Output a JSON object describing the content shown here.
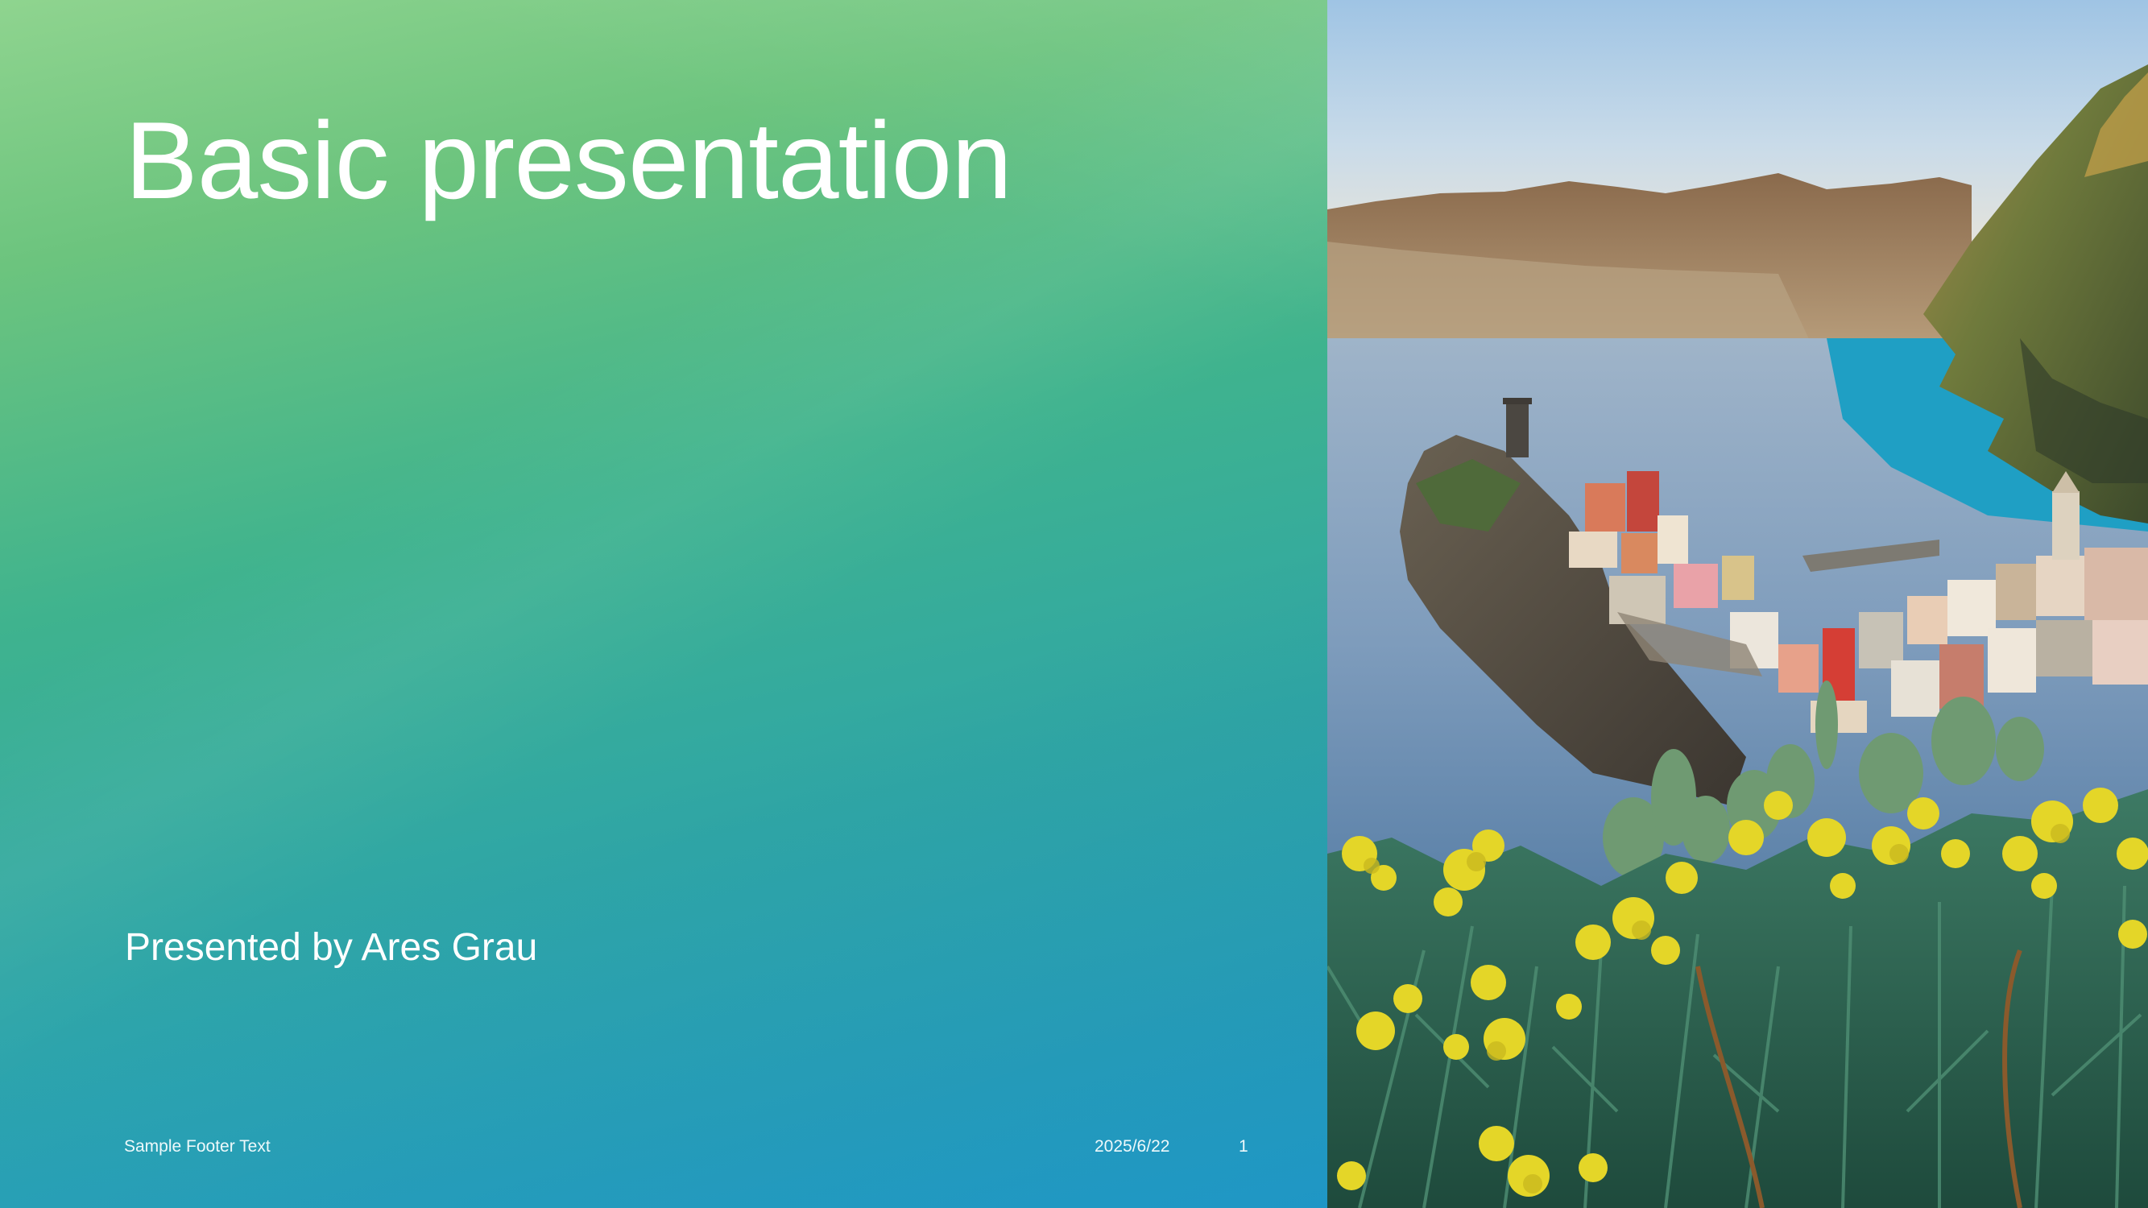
{
  "slide": {
    "title": "Basic presentation",
    "subtitle": "Presented by Ares Grau",
    "footer_text": "Sample Footer Text",
    "date": "2025/6/22",
    "page_number": "1"
  },
  "image": {
    "subject": "coastal-village-photo"
  },
  "colors": {
    "gradient_top": "#8fd48f",
    "gradient_mid": "#3fb38e",
    "gradient_bottom": "#22a3d3",
    "text": "#ffffff"
  }
}
